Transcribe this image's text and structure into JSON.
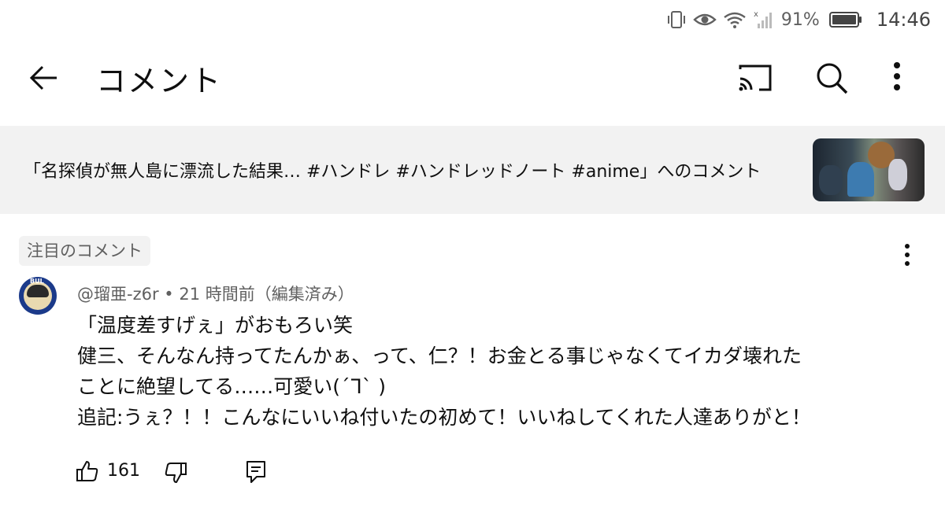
{
  "status_bar": {
    "battery_percent": "91%",
    "time": "14:46",
    "icons": [
      "vibrate-icon",
      "eye-icon",
      "wifi-icon",
      "signal-icon",
      "battery-icon"
    ]
  },
  "app_bar": {
    "title": "コメント",
    "icons": [
      "back-arrow-icon",
      "cast-icon",
      "search-icon",
      "more-vert-icon"
    ]
  },
  "video_banner": {
    "text": "「名探偵が無人島に漂流した結果… #ハンドレ #ハンドレッドノート #anime」へのコメント"
  },
  "comment": {
    "pinned_label": "注目のコメント",
    "author_meta": "@瑠亜-z6r • 21 時間前（編集済み）",
    "body_lines": [
      "「温度差すげぇ」がおもろい笑",
      "健三、そんなん持ってたんかぁ、って、仁？！お金とる事じゃなくてイカダ壊れた",
      "ことに絶望してる……可愛い(´ᒣ` )",
      "追記:うぇ？！！こんなにいいね付いたの初めて！いいねしてくれた人達ありがと！"
    ],
    "avatar_label": "BUL",
    "like_count": "161"
  },
  "colors": {
    "text_primary": "#0f0f0f",
    "text_secondary": "#606060",
    "banner_bg": "#f2f2f2"
  }
}
